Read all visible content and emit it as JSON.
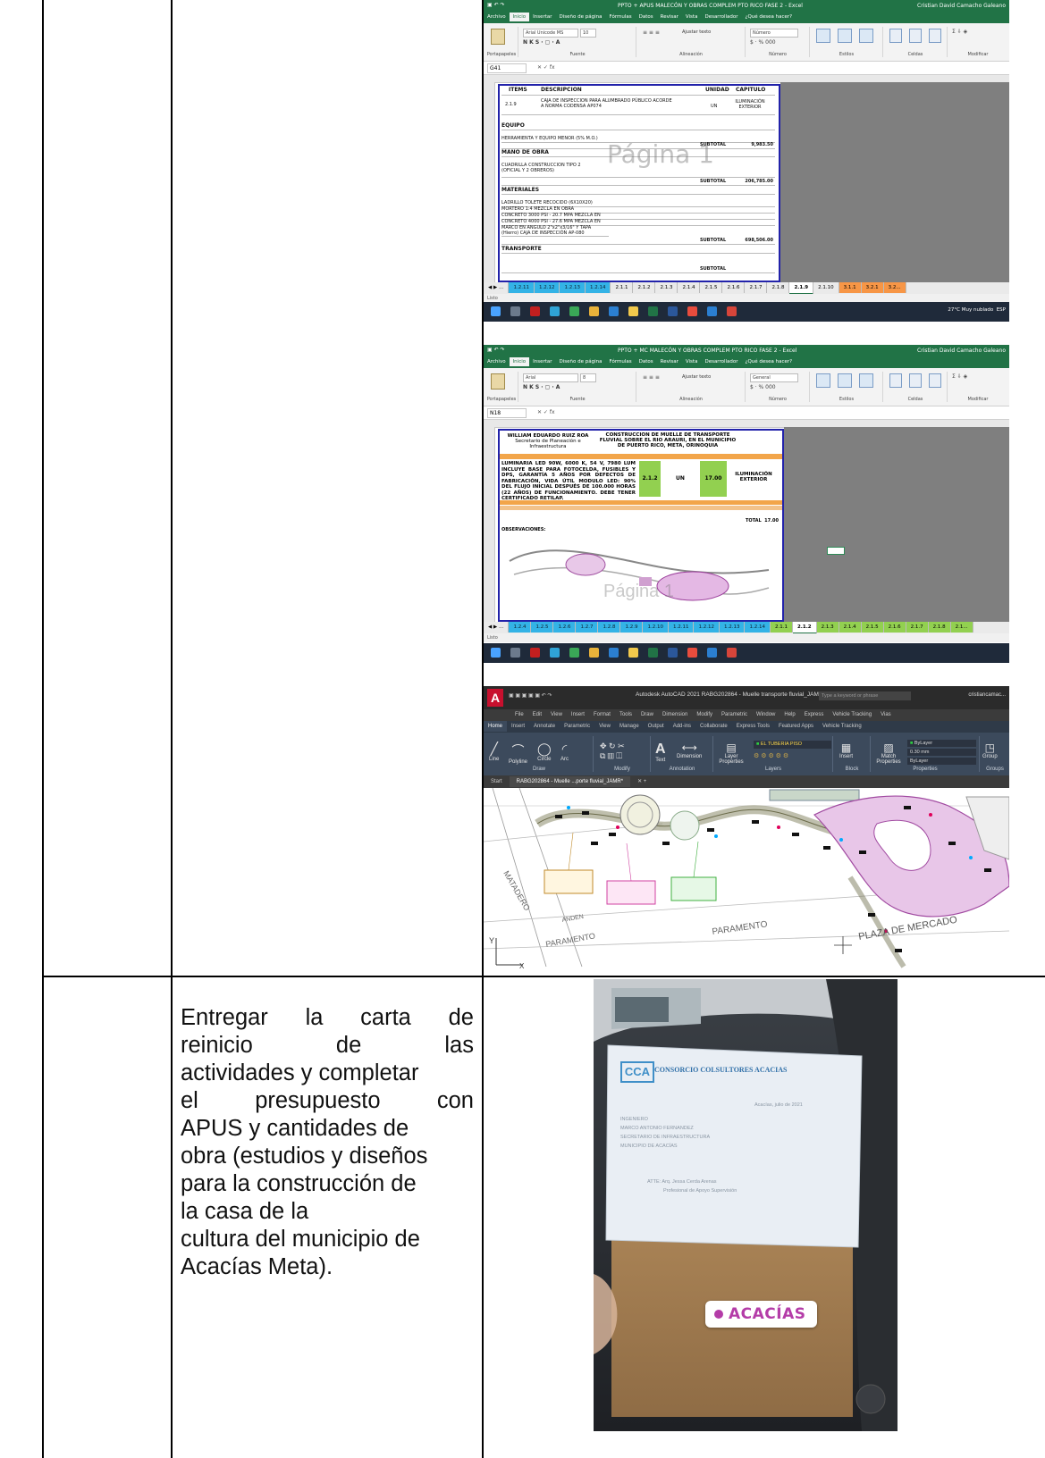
{
  "activity_text": {
    "lines": [
      "Entregar la carta de",
      "reinicio de las",
      "actividades y completar",
      "el presupuesto con",
      "APUS y cantidades de",
      "obra (estudios y diseños",
      "para la construcción de",
      "la casa de la",
      "cultura del municipio de",
      "Acacías Meta)."
    ],
    "words_row2": [
      "reinicio",
      "de",
      "las"
    ],
    "words_row4": [
      "el",
      "presupuesto",
      "con"
    ]
  },
  "excel1": {
    "title": "PPTO + APUS MALECÓN Y OBRAS COMPLEM PTO RICO FASE 2 - Excel",
    "user": "Cristian David Camacho Galeano",
    "menu": [
      "Archivo",
      "Inicio",
      "Insertar",
      "Diseño de página",
      "Fórmulas",
      "Datos",
      "Revisar",
      "Vista",
      "Desarrollador",
      "¿Qué desea hacer?"
    ],
    "font_name": "Arial Unicode MS",
    "font_size": "10",
    "wrap_text": "Ajustar texto",
    "number_format": "Número",
    "ribbon_groups": [
      "Portapapeles",
      "Fuente",
      "Alineación",
      "Número",
      "Estilos",
      "Celdas",
      "Modificar"
    ],
    "cell_ref": "G41",
    "table_header": [
      "ITEMS",
      "DESCRIPCION",
      "UNIDAD",
      "CAPITULO"
    ],
    "item_code": "2.1.9",
    "item_desc": "CAJA DE INSPECCION PARA ALUMBRADO PÚBLICO ACORDE A NORMA CODENSA AP074",
    "item_unit": "UN",
    "item_chapter": "ILUMINACIÓN EXTERIOR",
    "sections": [
      "EQUIPO",
      "MANO DE OBRA",
      "MATERIALES",
      "TRANSPORTE"
    ],
    "equipo_row": "HERRAMIENTA Y EQUIPO MENOR (5% M.O.)",
    "mano_row": "CUADRILLA CONSTRUCCION TIPO 2 (OFICIAL Y 2 OBREROS)",
    "materiales_rows": [
      "LADRILLO TOLETE RECOCIDO (6X10X20)",
      "MORTERO 1:4 MEZCLA EN OBRA",
      "CONCRETO 3000 PSI - 20.7 MPA MEZCLA EN",
      "CONCRETO 4000 PSI - 27.6 MPA MEZCLA EN",
      "MARCO EN ANGULO 2\"x2\"x3/16\" Y TAPA (Hierro) CAJA DE INSPECCIÓN AP-080"
    ],
    "subtotal_label": "SUBTOTAL",
    "subtotals": [
      "9,983.50",
      "206,785.00",
      "698,506.00"
    ],
    "watermark": "Página 1",
    "tabs": [
      "1.2.11",
      "1.2.12",
      "1.2.13",
      "1.2.14",
      "2.1.1",
      "2.1.2",
      "2.1.3",
      "2.1.4",
      "2.1.5",
      "2.1.6",
      "2.1.7",
      "2.1.8",
      "2.1.9",
      "2.1.10",
      "3.1.1",
      "3.2.1",
      "3.2..."
    ],
    "status": "Listo",
    "weather": "27°C Muy nublado",
    "lang": "ESP"
  },
  "excel2": {
    "title": "PPTO + MC MALECÓN Y OBRAS COMPLEM PTO RICO FASE 2 - Excel",
    "user": "Cristian David Camacho Galeano",
    "font_name": "Arial",
    "font_size": "8",
    "number_format": "General",
    "cell_ref": "N18",
    "signer": "WILLIAM EDUARDO RUIZ ROA",
    "signer_role": "Secretario de Planeación e Infraestructura",
    "project": "CONSTRUCCION DE MUELLE DE TRANSPORTE FLUVIAL SOBRE EL RIO ARAURI, EN EL MUNICIPIO DE PUERTO RICO, META, ORINOQUIA",
    "desc": "LUMINARIA LED 90W, 6000 K, 54 V, 7980 LUM INCLUYE BASE PARA FOTOCELDA, FUSIBLES Y DPS, GARANTÍA 5 AÑOS POR DEFECTOS DE FABRICACIÓN, VIDA ÚTIL MODULO LED: 90% DEL FLUJO INICIAL DESPUÉS DE 100.000 HORAS (22 AÑOS) DE FUNCIONAMIENTO. DEBE TENER CERTIFICADO RETILAP.",
    "item": "2.1.2",
    "unit": "UN",
    "qty": "17.00",
    "chapter": "ILUMINACIÓN EXTERIOR",
    "total_label": "TOTAL",
    "total_value": "17.00",
    "observaciones": "OBSERVACIONES:",
    "tabs": [
      "1.2.4",
      "1.2.5",
      "1.2.6",
      "1.2.7",
      "1.2.8",
      "1.2.9",
      "1.2.10",
      "1.2.11",
      "1.2.12",
      "1.2.13",
      "1.2.14",
      "2.1.1",
      "2.1.2",
      "2.1.3",
      "2.1.4",
      "2.1.5",
      "2.1.6",
      "2.1.7",
      "2.1.8",
      "2.1..."
    ],
    "status": "Listo"
  },
  "autocad": {
    "title": "Autodesk AutoCAD 2021   RABG202864 - Muelle transporte fluvial_JAMR.dwg",
    "search": "Type a keyword or phrase",
    "user": "cristiancamac...",
    "menu": [
      "File",
      "Edit",
      "View",
      "Insert",
      "Format",
      "Tools",
      "Draw",
      "Dimension",
      "Modify",
      "Parametric",
      "Window",
      "Help",
      "Express",
      "Vehicle Tracking",
      "Vias"
    ],
    "tabs": [
      "Home",
      "Insert",
      "Annotate",
      "Parametric",
      "View",
      "Manage",
      "Output",
      "Add-ins",
      "Collaborate",
      "Express Tools",
      "Featured Apps",
      "Vehicle Tracking"
    ],
    "draw_tools": [
      "Line",
      "Polyline",
      "Circle",
      "Arc"
    ],
    "groups": [
      "Draw",
      "Modify",
      "Annotation",
      "Layers",
      "Block",
      "Properties",
      "Groups"
    ],
    "text_tool": "Text",
    "dim_tool": "Dimension",
    "layer_tool": "Layer Properties",
    "insert_tool": "Insert",
    "match_tool": "Match Properties",
    "group_tool": "Group",
    "layer_name": "EL TUBERIA PISO",
    "bylayer": "ByLayer",
    "lineweight": "0.30 mm",
    "doc_tabs": [
      "Start",
      "RABG202864 - Muelle ...porte fluvial_JAMR*"
    ],
    "map_labels": [
      "MATADERO",
      "ANDEN",
      "PARAMENTO",
      "PARAMENTO",
      "PLAZA DE MERCADO"
    ],
    "axis_y": "Y",
    "axis_x": "X"
  },
  "photo": {
    "company": "CONSORCIO COLSULTORES ACACIAS",
    "logo": "CCA",
    "date_line": "Acacías, julio de 2021",
    "letter_lines": [
      "INGENIERO",
      "MARCO ANTONIO FERNANDEZ",
      "SECRETARIO DE INFRAESTRUCTURA",
      "MUNICIPIO DE ACACÍAS",
      "ATTE: Arq. Jessa Cerda Arenas",
      "Profesional de Apoyo Supervisión"
    ],
    "location_sticker": "ACACÍAS"
  }
}
